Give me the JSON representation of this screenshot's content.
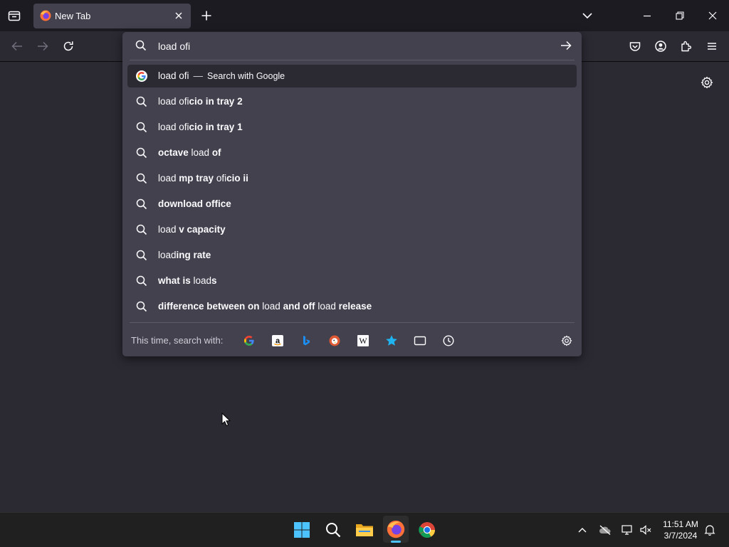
{
  "browser": {
    "tab": {
      "title": "New Tab"
    },
    "address_bar": {
      "value": "load ofi"
    }
  },
  "suggestions": [
    {
      "parts": [
        {
          "t": "load ofi",
          "b": false
        }
      ],
      "action": "Search with Google",
      "icon": "google-icon",
      "selected": true
    },
    {
      "parts": [
        {
          "t": "load ofi",
          "b": false
        },
        {
          "t": "cio in tray 2",
          "b": true
        }
      ],
      "icon": "search-icon"
    },
    {
      "parts": [
        {
          "t": "load ofi",
          "b": false
        },
        {
          "t": "cio in tray 1",
          "b": true
        }
      ],
      "icon": "search-icon"
    },
    {
      "parts": [
        {
          "t": "octave",
          "b": true
        },
        {
          "t": " load ",
          "b": false
        },
        {
          "t": "of",
          "b": true
        }
      ],
      "icon": "search-icon"
    },
    {
      "parts": [
        {
          "t": "load ",
          "b": false
        },
        {
          "t": "mp tray",
          "b": true
        },
        {
          "t": " ofi",
          "b": false
        },
        {
          "t": "cio ii",
          "b": true
        }
      ],
      "icon": "search-icon"
    },
    {
      "parts": [
        {
          "t": "download office",
          "b": true
        }
      ],
      "icon": "search-icon"
    },
    {
      "parts": [
        {
          "t": "load ",
          "b": false
        },
        {
          "t": "v capacity",
          "b": true
        }
      ],
      "icon": "search-icon"
    },
    {
      "parts": [
        {
          "t": "load",
          "b": false
        },
        {
          "t": "ing rate",
          "b": true
        }
      ],
      "icon": "search-icon"
    },
    {
      "parts": [
        {
          "t": "what is",
          "b": true
        },
        {
          "t": " load",
          "b": false
        },
        {
          "t": "s",
          "b": true
        }
      ],
      "icon": "search-icon"
    },
    {
      "parts": [
        {
          "t": "difference between on",
          "b": true
        },
        {
          "t": " load ",
          "b": false
        },
        {
          "t": "and off",
          "b": true
        },
        {
          "t": " load ",
          "b": false
        },
        {
          "t": "release",
          "b": true
        }
      ],
      "icon": "search-icon"
    }
  ],
  "one_off": {
    "label": "This time, search with:",
    "engines": [
      "google-icon",
      "amazon-icon",
      "bing-icon",
      "duckduckgo-icon",
      "wikipedia-icon",
      "bookmarks-icon",
      "tabs-icon",
      "history-icon"
    ]
  },
  "taskbar": {
    "time": "11:51 AM",
    "date": "3/7/2024"
  },
  "colors": {
    "accent": "#0060df",
    "popup_bg": "#42414d",
    "page_bg": "#2b2a33",
    "tabstrip_bg": "#1c1b22"
  }
}
